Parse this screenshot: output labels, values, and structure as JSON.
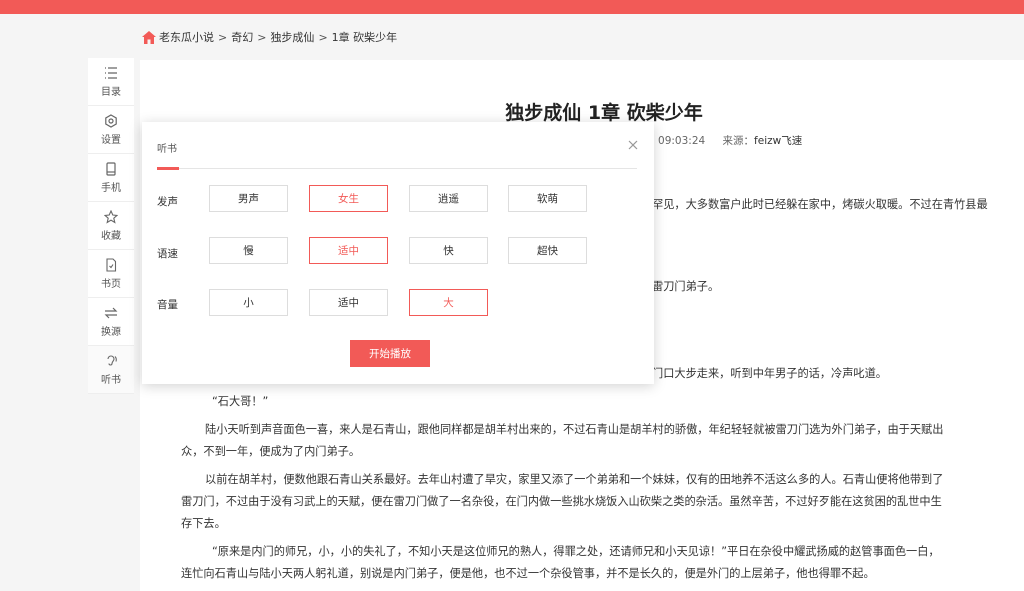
{
  "colors": {
    "accent": "#f25a57"
  },
  "breadcrumb": {
    "items": [
      "老东瓜小说",
      "奇幻",
      "独步成仙",
      "1章 砍柴少年"
    ],
    "separator": ">"
  },
  "sidebar": {
    "items": [
      {
        "label": "目录",
        "icon": "list-icon"
      },
      {
        "label": "设置",
        "icon": "gear-icon"
      },
      {
        "label": "手机",
        "icon": "phone-icon"
      },
      {
        "label": "收藏",
        "icon": "star-icon"
      },
      {
        "label": "书页",
        "icon": "book-page-icon"
      },
      {
        "label": "换源",
        "icon": "swap-icon"
      },
      {
        "label": "听书",
        "icon": "listen-icon"
      }
    ]
  },
  "chapter": {
    "title": "独步成仙 1章 砍柴少年",
    "time_fragment": "7 09:03:24",
    "source_label": "来源：",
    "source_value": "feizw飞速"
  },
  "paragraph_fragments": {
    "p1": "罕见，大多数富户此时已经躲在家中，烤碳火取暖。不过在青竹县最",
    "p2": "雷刀门弟子。",
    "p3": "门口大步走来，听到中年男子的话，冷声叱道。"
  },
  "paragraphs": {
    "p4": "“石大哥！”",
    "p5a": "陆小天听到声音面色一喜，来人是石青山，跟他同样都是胡羊村出来的，不过石青山是胡羊村的骄傲，年纪轻轻就被雷刀门选为外门弟子，由于天赋出",
    "p5b": "众，不到一年，便成为了内门弟子。",
    "p6a": "以前在胡羊村，便数他跟石青山关系最好。去年山村遭了旱灾，家里又添了一个弟弟和一个妹妹，仅有的田地养不活这么多的人。石青山便将他带到了",
    "p6b": "雷刀门，不过由于没有习武上的天赋，便在雷刀门做了一名杂役，在门内做一些挑水烧饭入山砍柴之类的杂活。虽然辛苦，不过好歹能在这贫困的乱世中生",
    "p6c": "存下去。",
    "p7a": "“原来是内门的师兄，小，小的失礼了，不知小天是这位师兄的熟人，得罪之处，还请师兄和小天见谅！”平日在杂役中耀武扬威的赵管事面色一白，",
    "p7b": "连忙向石青山与陆小天两人躬礼道，别说是内门弟子，便是他，也不过一个杂役管事，并不是长久的，便是外门的上层弟子，他也得罪不起。"
  },
  "tts_panel": {
    "tab": "听书",
    "voice": {
      "label": "发声",
      "options": [
        "男声",
        "女生",
        "逍遥",
        "软萌"
      ],
      "selected": "女生"
    },
    "speed": {
      "label": "语速",
      "options": [
        "慢",
        "适中",
        "快",
        "超快"
      ],
      "selected": "适中"
    },
    "volume": {
      "label": "音量",
      "options": [
        "小",
        "适中",
        "大"
      ],
      "selected": "大"
    },
    "start_button": "开始播放"
  }
}
